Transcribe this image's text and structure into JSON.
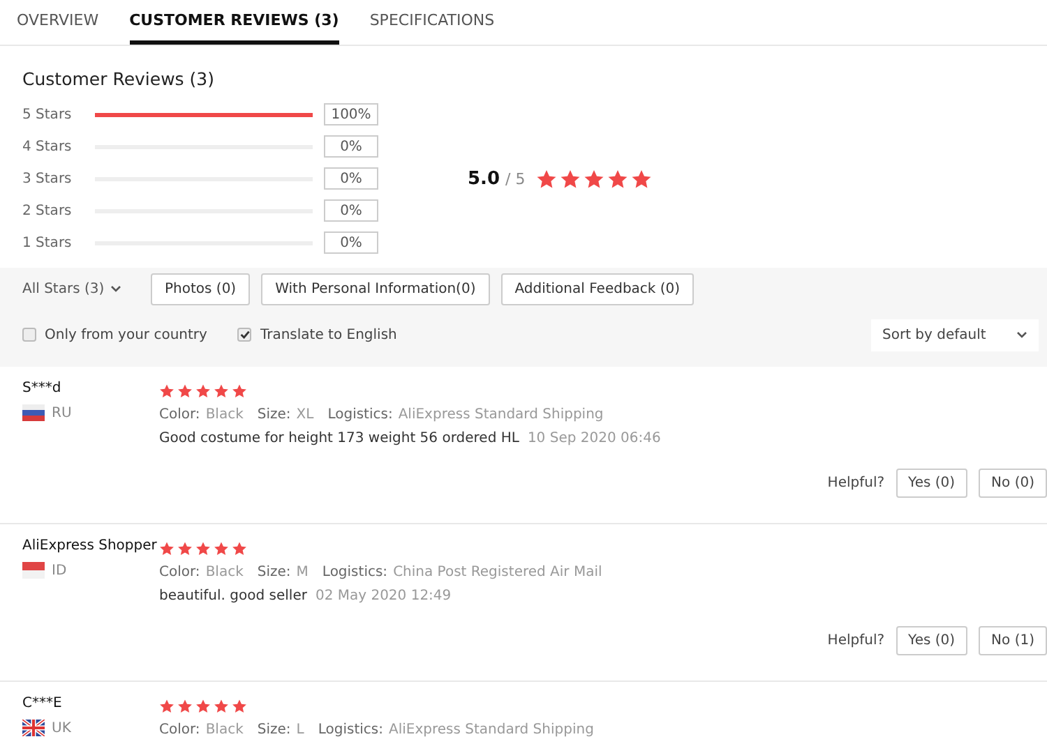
{
  "tabs": [
    {
      "label": "OVERVIEW",
      "selected": false
    },
    {
      "label": "CUSTOMER REVIEWS (3)",
      "selected": true
    },
    {
      "label": "SPECIFICATIONS",
      "selected": false
    }
  ],
  "summary": {
    "title": "Customer Reviews (3)",
    "score": "5.0",
    "out_of": "/ 5",
    "stars": 5,
    "bars": [
      {
        "label": "5 Stars",
        "level": 1,
        "percent": "100%"
      },
      {
        "label": "4 Stars",
        "level": 0,
        "percent": "0%"
      },
      {
        "label": "3 Stars",
        "level": 0,
        "percent": "0%"
      },
      {
        "label": "2 Stars",
        "level": 0,
        "percent": "0%"
      },
      {
        "label": "1 Stars",
        "level": 0,
        "percent": "0%"
      }
    ]
  },
  "filters": {
    "dropdown": "All Stars (3)",
    "buttons": [
      "Photos (0)",
      "With Personal Information(0)",
      "Additional Feedback (0)"
    ],
    "checkboxes": [
      {
        "label": "Only from your country",
        "checked": false
      },
      {
        "label": "Translate to English",
        "checked": true
      }
    ],
    "sort": "Sort by default"
  },
  "reviews": [
    {
      "name": "S***d",
      "kind": "ru",
      "country": "RU",
      "stars": 5,
      "attributes": [
        {
          "label": "Color:",
          "value": "Black"
        },
        {
          "label": "Size:",
          "value": "XL"
        },
        {
          "label": "Logistics:",
          "value": "AliExpress Standard Shipping"
        }
      ],
      "text": "Good costume for height 173 weight 56 ordered HL",
      "date": "10 Sep 2020 06:46",
      "helpful": "Helpful?",
      "yes": "Yes (0)",
      "no": "No (0)"
    },
    {
      "name": "AliExpress Shopper",
      "kind": "id",
      "country": "ID",
      "stars": 5,
      "attributes": [
        {
          "label": "Color:",
          "value": "Black"
        },
        {
          "label": "Size:",
          "value": "M"
        },
        {
          "label": "Logistics:",
          "value": "China Post Registered Air Mail"
        }
      ],
      "text": "beautiful. good seller",
      "date": "02 May 2020 12:49",
      "helpful": "Helpful?",
      "yes": "Yes (0)",
      "no": "No (1)"
    },
    {
      "name": "C***E",
      "kind": "uk",
      "country": "UK",
      "stars": 5,
      "attributes": [
        {
          "label": "Color:",
          "value": "Black"
        },
        {
          "label": "Size:",
          "value": "L"
        },
        {
          "label": "Logistics:",
          "value": "AliExpress Standard Shipping"
        }
      ]
    }
  ]
}
